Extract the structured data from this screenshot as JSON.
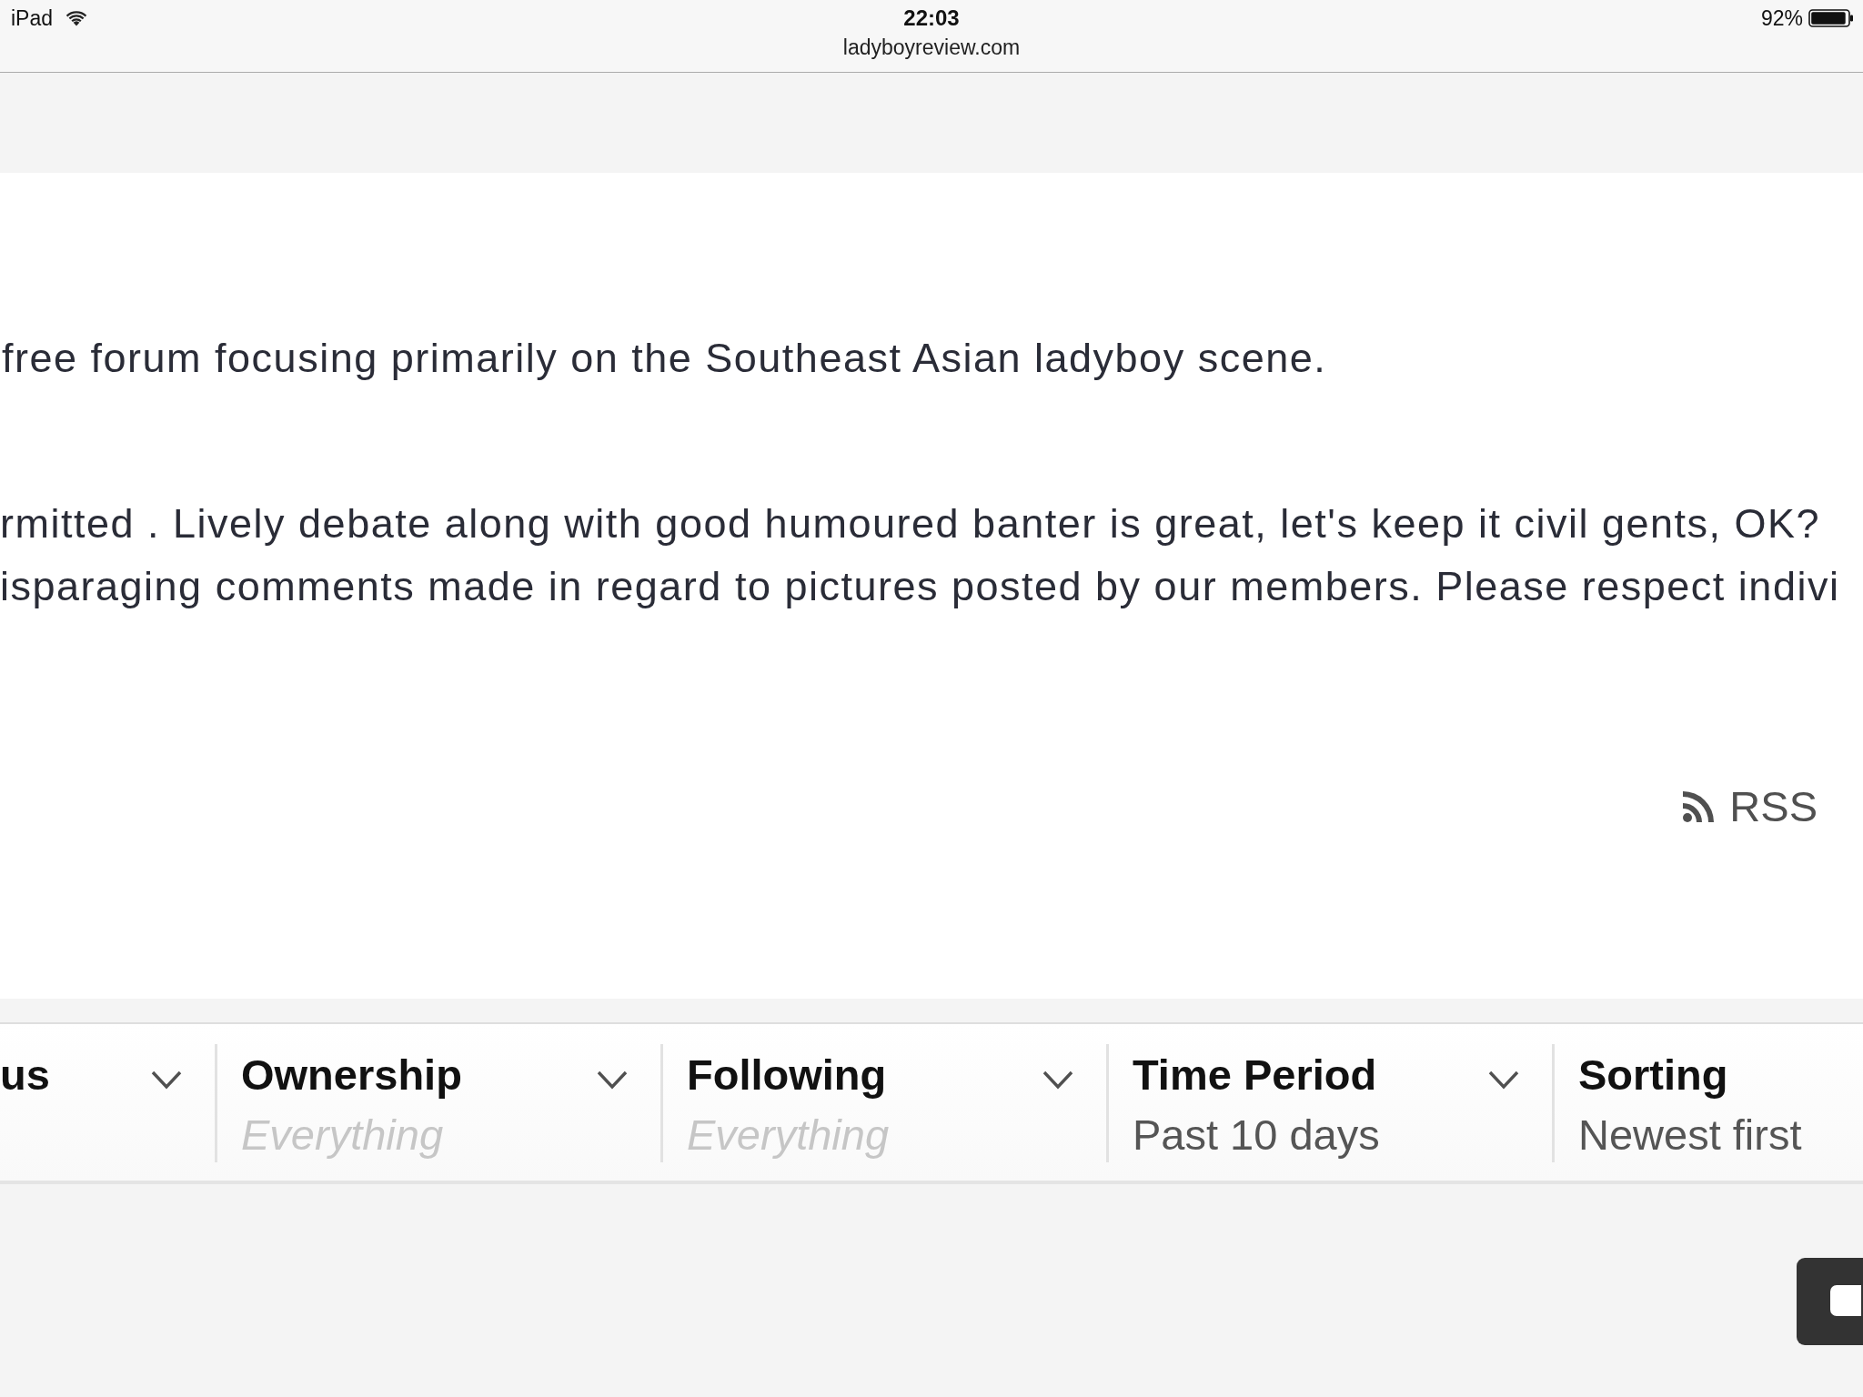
{
  "status_bar": {
    "device": "iPad",
    "time": "22:03",
    "url": "ladyboyreview.com",
    "battery": "92%"
  },
  "intro": {
    "text": "free forum focusing primarily on the Southeast Asian ladyboy scene."
  },
  "rules": {
    "lines": [
      "rmitted . Lively debate along with good humoured banter is great, let's keep it civil gents, OK?",
      "isparaging comments made in regard to pictures posted by our members. Please respect indivi"
    ]
  },
  "rss_link": {
    "label": "RSS"
  },
  "filters": [
    {
      "label": "us",
      "show_chevron": true
    },
    {
      "label": "Ownership",
      "value": "Everything",
      "is_default": true,
      "show_chevron": true
    },
    {
      "label": "Following",
      "value": "Everything",
      "is_default": true,
      "show_chevron": true
    },
    {
      "label": "Time Period",
      "value": "Past 10 days",
      "is_default": false,
      "show_chevron": true
    },
    {
      "label": "Sorting",
      "value": "Newest first",
      "is_default": false,
      "show_chevron": false
    }
  ]
}
